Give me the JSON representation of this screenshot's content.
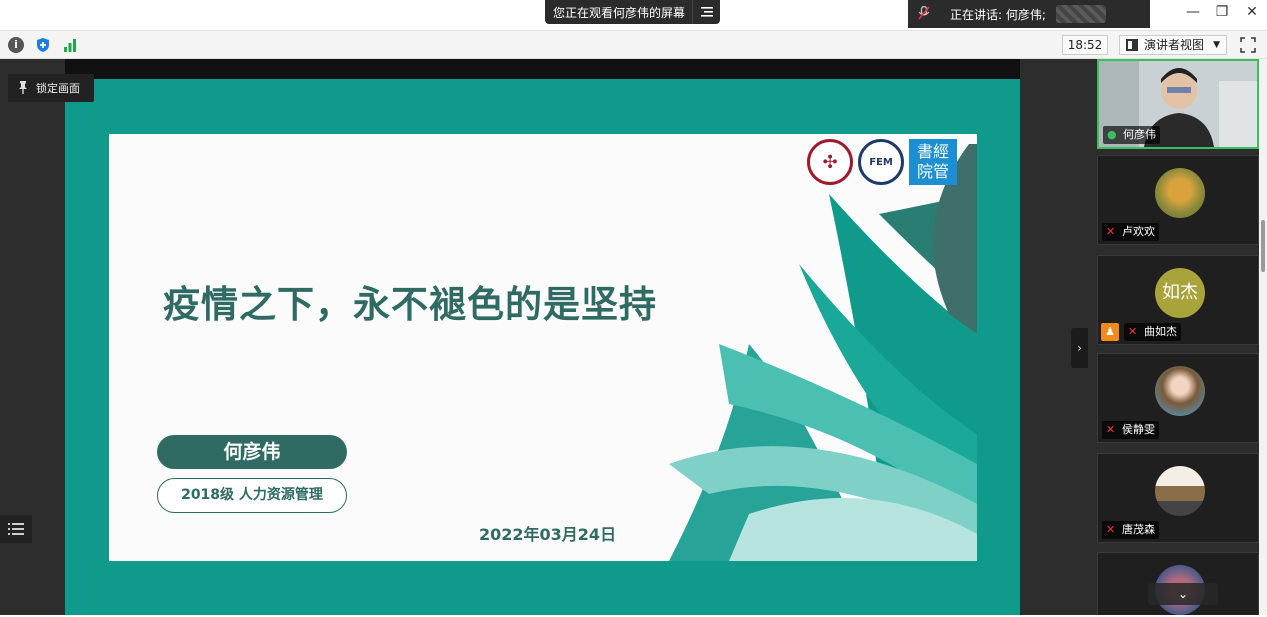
{
  "titlebar": {
    "share_notice": "您正在观看何彦伟的屏幕",
    "speaker_notice": "正在讲话: 何彦伟;",
    "menu_icon": "menu-icon",
    "minimize": "—",
    "restore": "❐",
    "close": "✕"
  },
  "toolbar": {
    "time": "18:52",
    "view_label": "演讲者视图",
    "view_caret": "▼",
    "info_glyph": "i"
  },
  "lock": {
    "label": "锁定画面"
  },
  "slide": {
    "title": "疫情之下，永不褪色的是坚持",
    "name": "何彦伟",
    "major": "2018级 人力资源管理",
    "date": "2022年03月24日",
    "logo_fem": "FEM",
    "logo_text": "書經院管",
    "colors": {
      "primary": "#2f6b62",
      "teal": "#0f9a8c"
    }
  },
  "participants": [
    {
      "name": "何彦伟",
      "mic": "on"
    },
    {
      "name": "卢欢欢",
      "mic": "muted"
    },
    {
      "name": "曲如杰",
      "mic": "muted",
      "avatar_text": "如杰"
    },
    {
      "name": "侯静雯",
      "mic": "muted"
    },
    {
      "name": "唐茂森",
      "mic": "muted"
    }
  ],
  "gallery": {
    "collapse_glyph": "›",
    "scroll_glyph": "⌄"
  }
}
